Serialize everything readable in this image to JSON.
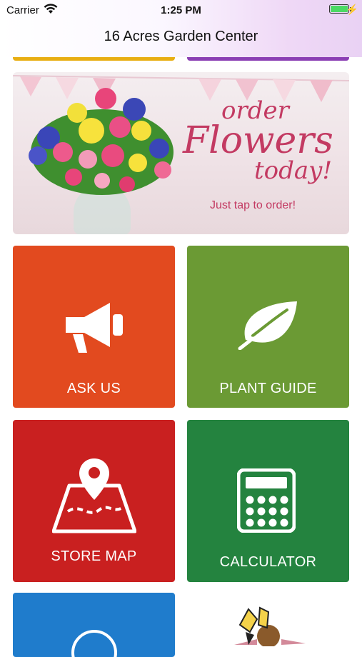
{
  "status_bar": {
    "carrier": "Carrier",
    "time": "1:25 PM"
  },
  "header": {
    "title": "16 Acres Garden Center"
  },
  "banner": {
    "line1": "order",
    "line2": "Flowers",
    "line3": "today!",
    "tagline": "Just tap to order!"
  },
  "tiles": [
    {
      "label": "ASK US",
      "color": "#e24a1f",
      "icon": "megaphone-icon"
    },
    {
      "label": "PLANT GUIDE",
      "color": "#6b9a34",
      "icon": "leaf-icon"
    },
    {
      "label": "STORE MAP",
      "color": "#c92020",
      "icon": "map-pin-icon"
    },
    {
      "label": "CALCULATOR",
      "color": "#24833f",
      "icon": "calculator-icon"
    },
    {
      "label": "",
      "color": "#1f7ccc",
      "icon": "circle-icon"
    }
  ],
  "colors": {
    "header_tint": "#e9d2f4",
    "peek_yellow": "#e8ae12",
    "peek_purple": "#8b3fb4"
  }
}
